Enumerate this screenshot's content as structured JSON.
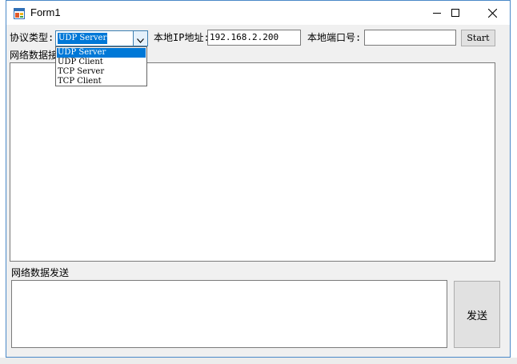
{
  "window": {
    "title": "Form1",
    "icon": "form-app-icon",
    "controls": {
      "minimize": "minimize-icon",
      "maximize": "maximize-icon",
      "close": "close-icon"
    },
    "accent_color": "#4a89c8"
  },
  "toolbar": {
    "protocol_label": "协议类型:",
    "protocol_selected": "UDP Server",
    "protocol_options": [
      "UDP Server",
      "UDP Client",
      "TCP Server",
      "TCP Client"
    ],
    "ip_label": "本地IP地址:",
    "ip_value": "192.168.2.200",
    "port_label": "本地端口号:",
    "port_value": "",
    "start_label": "Start"
  },
  "receive": {
    "label": "网络数据接",
    "content": ""
  },
  "send": {
    "label": "网络数据发送",
    "content": "",
    "button_label": "发送"
  },
  "colors": {
    "selection": "#0078d7",
    "focus_border": "#3c7fb1"
  }
}
